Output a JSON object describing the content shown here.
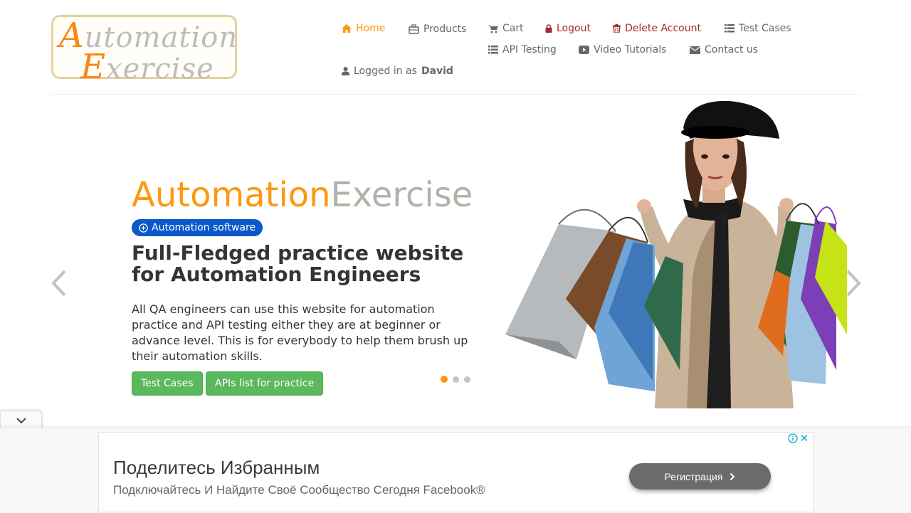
{
  "logo": {
    "line1_cap": "A",
    "line1_rest": "utomation",
    "line2_cap": "E",
    "line2_rest": "xercise"
  },
  "nav": {
    "home": "Home",
    "products": "Products",
    "cart": "Cart",
    "logout": "Logout",
    "delete_account": "Delete Account",
    "test_cases": "Test Cases",
    "api_testing": "API Testing",
    "video_tutorials": "Video Tutorials",
    "contact_us": "Contact us",
    "logged_in_prefix": "Logged in as",
    "logged_in_user": "David"
  },
  "slider": {
    "title_part1": "Automation",
    "title_part2": "Exercise",
    "badge": "Automation software",
    "headline": "Full-Fledged practice website for Automation Engineers",
    "description": "All QA engineers can use this website for automation practice and API testing either they are at beginner or advance level. This is for everybody to help them brush up their automation skills.",
    "btn_test_cases": "Test Cases",
    "btn_apis": "APIs list for practice",
    "active_slide": 1,
    "slide_count": 3
  },
  "ad": {
    "title": "Поделитесь Избранным",
    "subtitle": "Подключайтесь И Найдите Своё Сообщество Сегодня Facebook®",
    "button": "Регистрация"
  },
  "colors": {
    "accent": "#fe980f",
    "danger": "#a52a2a",
    "nav_text": "#696763",
    "badge_bg": "#0a58ca",
    "button_green": "#5cb85c"
  }
}
